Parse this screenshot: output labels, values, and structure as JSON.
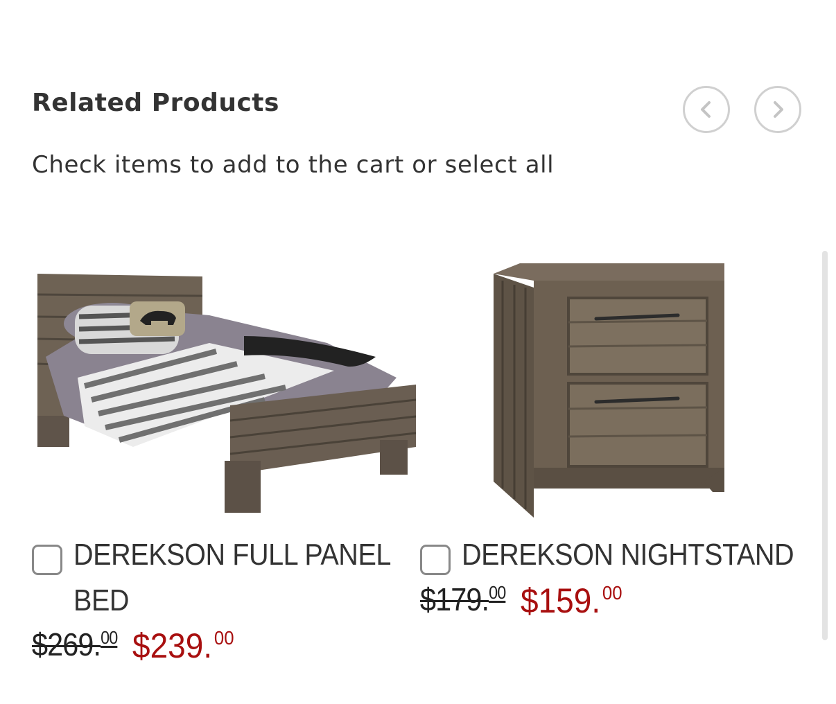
{
  "section": {
    "title": "Related Products",
    "subtitle": "Check items to add to the cart or select all"
  },
  "nav": {
    "prev_icon": "chevron-left-icon",
    "next_icon": "chevron-right-icon"
  },
  "products": [
    {
      "name_line1": "DEREKSON FULL PANEL",
      "name_line2": "BED",
      "old_price_main": "$269.",
      "old_price_cents": "00",
      "new_price_main": "$239.",
      "new_price_cents": "00",
      "checked": false
    },
    {
      "name_line1": "DEREKSON NIGHTSTAND",
      "name_line2": "",
      "old_price_main": "$179.",
      "old_price_cents": "00",
      "new_price_main": "$159.",
      "new_price_cents": "00",
      "checked": false
    }
  ],
  "colors": {
    "sale_price": "#a80f0f",
    "text": "#333333",
    "nav_border": "#d0d0d0"
  }
}
